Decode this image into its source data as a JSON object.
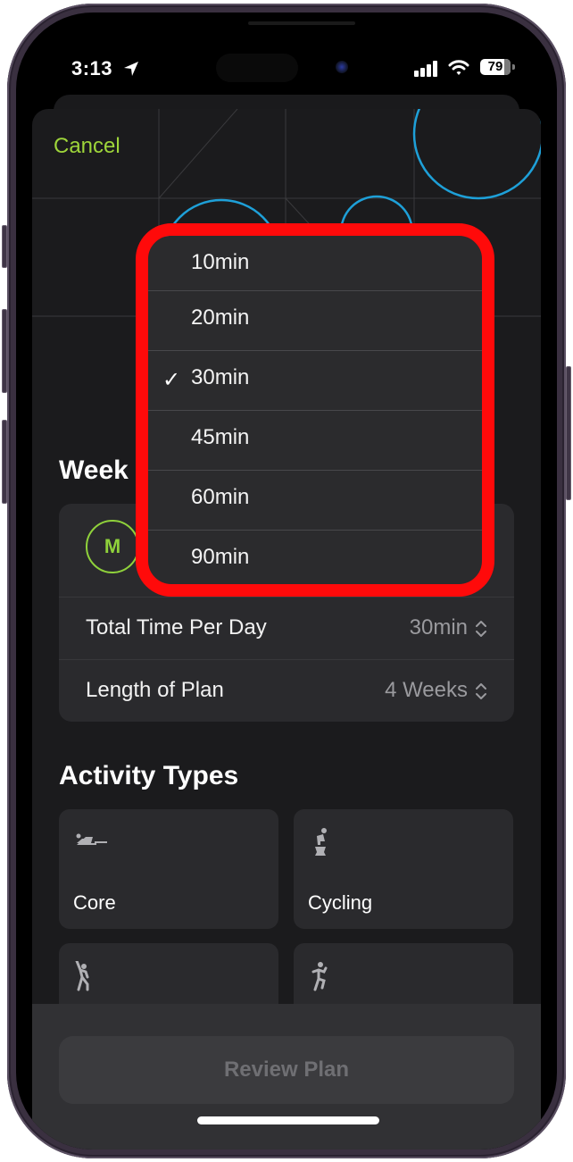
{
  "status_bar": {
    "time": "3:13",
    "battery_percent": "79",
    "battery_level": 0.79
  },
  "sheet": {
    "cancel_label": "Cancel",
    "week_section_title": "Weekly Schedule",
    "week_section_visible_text": "Week",
    "days": [
      {
        "letter": "M",
        "selected": true
      }
    ],
    "settings": [
      {
        "label": "Total Time Per Day",
        "value": "30min"
      },
      {
        "label": "Length of Plan",
        "value": "4 Weeks"
      }
    ],
    "activity_section_title": "Activity Types",
    "activities": [
      {
        "label": "Core",
        "icon": "core-training-icon"
      },
      {
        "label": "Cycling",
        "icon": "indoor-cycling-icon"
      },
      {
        "label": "",
        "icon": "dance-icon"
      },
      {
        "label": "",
        "icon": "hiit-icon"
      }
    ],
    "review_button_label": "Review Plan"
  },
  "duration_menu": {
    "options": [
      {
        "label": "10min",
        "selected": false
      },
      {
        "label": "20min",
        "selected": false
      },
      {
        "label": "30min",
        "selected": true
      },
      {
        "label": "45min",
        "selected": false
      },
      {
        "label": "60min",
        "selected": false
      },
      {
        "label": "90min",
        "selected": false
      }
    ],
    "check_glyph": "✓"
  },
  "colors": {
    "accent_green": "#9ed53a",
    "highlight_red": "#ff0a0a",
    "art_blue": "#1ea0d8"
  }
}
